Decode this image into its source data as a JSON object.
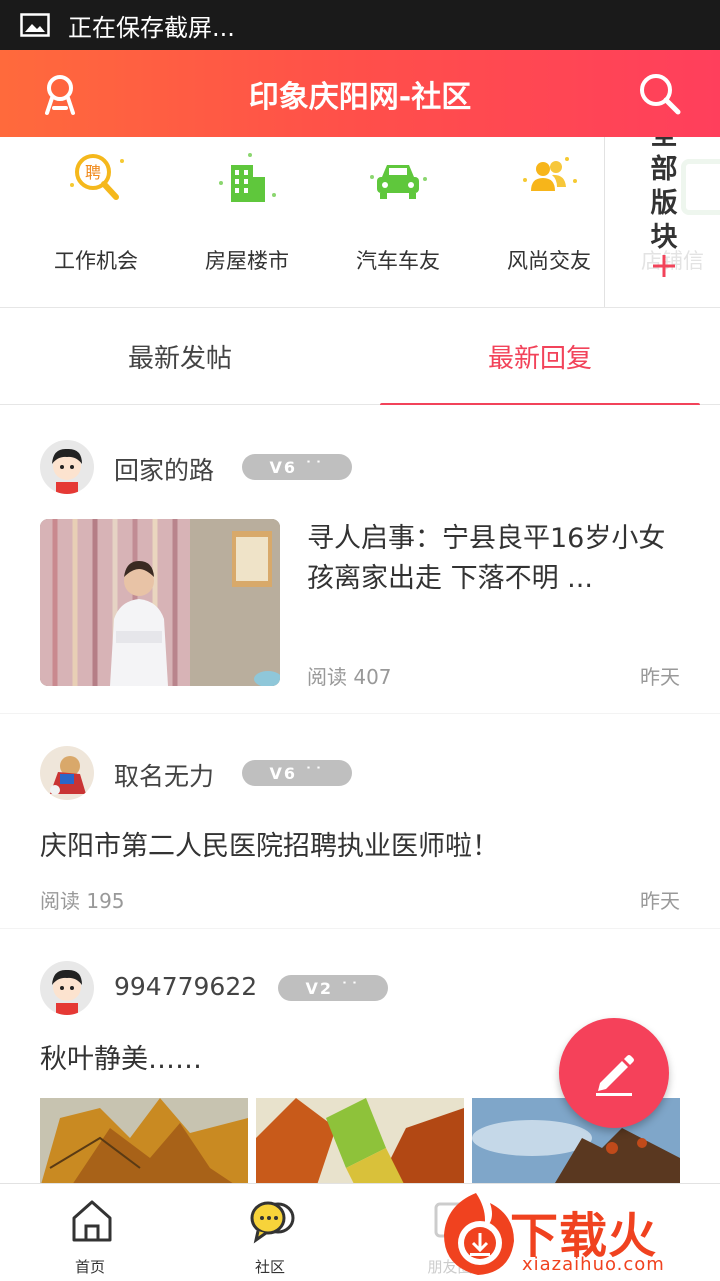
{
  "status_bar": {
    "text": "正在保存截屏..."
  },
  "header": {
    "title": "印象庆阳网-社区"
  },
  "categories": [
    {
      "label": "工作机会",
      "icon": "recruit-icon"
    },
    {
      "label": "房屋楼市",
      "icon": "building-icon"
    },
    {
      "label": "汽车车友",
      "icon": "car-icon"
    },
    {
      "label": "风尚交友",
      "icon": "friends-icon"
    }
  ],
  "all_sections": {
    "label": "全部版块",
    "partial_next_label": "店铺信"
  },
  "tabs": [
    {
      "label": "最新发帖",
      "active": false
    },
    {
      "label": "最新回复",
      "active": true
    }
  ],
  "posts": [
    {
      "username": "回家的路",
      "level": "V6 ˙˙",
      "title": "寻人启事：宁县良平16岁小女孩离家出走 下落不明 ...",
      "reads": "阅读 407",
      "time": "昨天"
    },
    {
      "username": "取名无力",
      "level": "V6 ˙˙",
      "title": "庆阳市第二人民医院招聘执业医师啦！",
      "reads": "阅读 195",
      "time": "昨天"
    },
    {
      "username": "994779622",
      "level": "V2 ˙˙",
      "title": "秋叶静美……"
    }
  ],
  "bottom_nav": [
    {
      "label": "首页",
      "icon": "home-icon"
    },
    {
      "label": "社区",
      "icon": "community-icon"
    },
    {
      "label": "朋友圈",
      "icon": "moments-icon"
    }
  ],
  "watermark": {
    "brand": "下载火",
    "url": "xiazaihuo.com"
  },
  "colors": {
    "accent": "#f2435a",
    "header_start": "#ff6a3c",
    "header_end": "#ff3f5c"
  }
}
